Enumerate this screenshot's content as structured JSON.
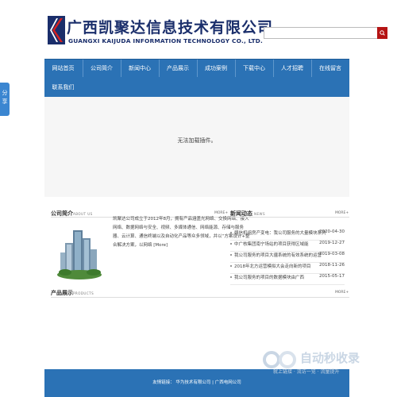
{
  "share_tab": {
    "label": "分享"
  },
  "header": {
    "company_name_cn": "广西凯聚达信息技术有限公司",
    "company_name_en": "GUANGXI KAIJUDA INFORMATION TECHNOLOGY CO., LTD.",
    "search_placeholder": ""
  },
  "nav": {
    "row1": [
      "网站首页",
      "公司简介",
      "新闻中心",
      "产品展示",
      "成功案例",
      "下载中心",
      "人才招聘",
      "在线留言"
    ],
    "row2": [
      "联系我们"
    ]
  },
  "banner": {
    "message": "无法加载插件。"
  },
  "about": {
    "title": "公司简介",
    "subtitle": "ABOUT US",
    "more": "MORE+",
    "text": "凯聚达公司成立于2012年8月，拥有产品涵盖光网络、交换网络、接入网络、数据网络与安全、视频、多媒体通信、网络能源、存储与服务器、云计算、通信终端以及自动化产品等众多领域，并以“方案设计+整合解决方案，以网络 [More]"
  },
  "news": {
    "title": "新闻动态",
    "subtitle": "NEWS",
    "more": "MORE+",
    "items": [
      {
        "title": "疆信机组房产变电：我公司服务的大量模块系列",
        "date": "2020-04-30"
      },
      {
        "title": "中广核集团南宁场站的项目获得区域能",
        "date": "2019-12-27"
      },
      {
        "title": "我公司服务的项目大疆系统的有效系统的运营",
        "date": "2019-03-08"
      },
      {
        "title": "2018年北方运营模拟大会走向新的项目",
        "date": "2018-11-26"
      },
      {
        "title": "我公司服务的项目的数据模块由广西",
        "date": "2015-05-17"
      }
    ]
  },
  "products": {
    "title": "产品展示",
    "subtitle": "PRODUCTS",
    "more": "MORE+"
  },
  "footer": {
    "text": "友情链接：  华为技术有限公司  |  广西电网公司"
  },
  "watermark": {
    "main": "自动秒收录",
    "sub": "就上链接 · 流访一览 · 流量提升"
  }
}
